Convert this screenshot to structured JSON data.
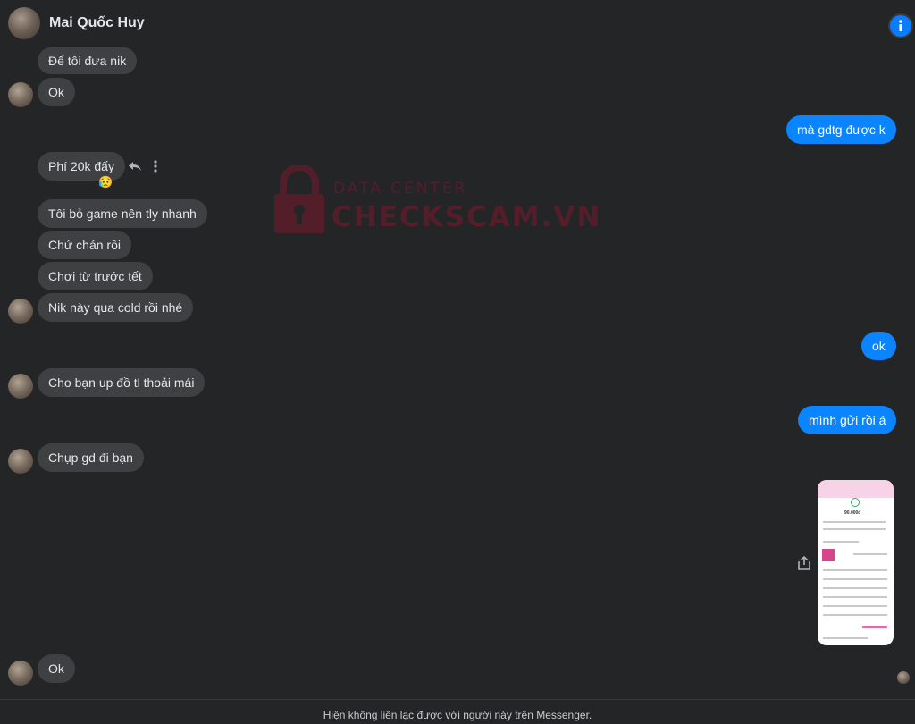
{
  "header": {
    "contact_name": "Mai Quốc Huy",
    "info_icon": "info-icon"
  },
  "watermark": {
    "top_text": "DATA CENTER",
    "main_text": "CHECKSCAM.VN"
  },
  "messages": [
    {
      "side": "in",
      "text": "Để tôi đưa nik"
    },
    {
      "side": "in",
      "text": "Ok"
    },
    {
      "side": "out",
      "text": "mà gdtg được k"
    },
    {
      "side": "in",
      "text": "Phí 20k đấy",
      "reaction": "😥"
    },
    {
      "side": "in",
      "text": "Tôi bỏ game nên tly nhanh"
    },
    {
      "side": "in",
      "text": "Chứ chán rồi"
    },
    {
      "side": "in",
      "text": "Chơi từ trước tết"
    },
    {
      "side": "in",
      "text": "Nik này qua cold rồi nhé"
    },
    {
      "side": "out",
      "text": "ok"
    },
    {
      "side": "in",
      "text": "Cho bạn up đồ tl thoải mái"
    },
    {
      "side": "out",
      "text": "mình gửi rồi á"
    },
    {
      "side": "in",
      "text": "Chụp gd đi bạn"
    },
    {
      "side": "out",
      "type": "image",
      "description_icon": "bank-transfer-receipt-image"
    },
    {
      "side": "in",
      "text": "Ok"
    }
  ],
  "receipt_image": {
    "amount": "90.000đ"
  },
  "footer": {
    "notice": "Hiện không liên lạc được với người này trên Messenger."
  },
  "colors": {
    "background": "#242526",
    "incoming_bubble": "#3e4042",
    "outgoing_bubble": "#0a84ff",
    "accent": "#0a7cff",
    "watermark": "#7a1a2e"
  }
}
